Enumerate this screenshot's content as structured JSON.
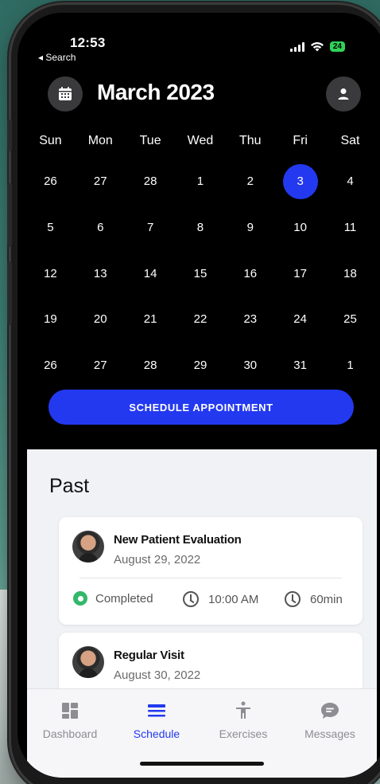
{
  "status_bar": {
    "time": "12:53",
    "back_label": "◂ Search",
    "battery": "24"
  },
  "header": {
    "title": "March 2023",
    "calendar_icon": "calendar-icon",
    "profile_icon": "person-icon"
  },
  "calendar": {
    "weekdays": [
      "Sun",
      "Mon",
      "Tue",
      "Wed",
      "Thu",
      "Fri",
      "Sat"
    ],
    "weeks": [
      [
        "26",
        "27",
        "28",
        "1",
        "2",
        "3",
        "4"
      ],
      [
        "5",
        "6",
        "7",
        "8",
        "9",
        "10",
        "11"
      ],
      [
        "12",
        "13",
        "14",
        "15",
        "16",
        "17",
        "18"
      ],
      [
        "19",
        "20",
        "21",
        "22",
        "23",
        "24",
        "25"
      ],
      [
        "26",
        "27",
        "28",
        "29",
        "30",
        "31",
        "1"
      ]
    ],
    "selected_day": "3",
    "accent_color": "#2339f0"
  },
  "schedule_button": {
    "label": "SCHEDULE APPOINTMENT"
  },
  "past": {
    "title": "Past",
    "appointments": [
      {
        "title": "New Patient Evaluation",
        "date": "August 29, 2022",
        "status": "Completed",
        "time": "10:00 AM",
        "duration": "60min"
      },
      {
        "title": "Regular Visit",
        "date": "August 30, 2022"
      }
    ]
  },
  "tabbar": {
    "items": [
      {
        "label": "Dashboard",
        "icon": "dashboard-icon"
      },
      {
        "label": "Schedule",
        "icon": "schedule-icon",
        "active": true
      },
      {
        "label": "Exercises",
        "icon": "exercise-icon"
      },
      {
        "label": "Messages",
        "icon": "chat-icon"
      }
    ]
  }
}
